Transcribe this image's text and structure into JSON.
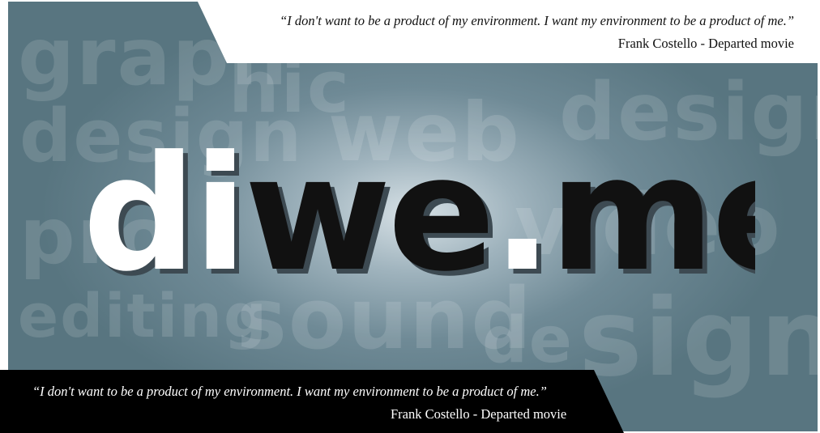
{
  "background_words": [
    "graph",
    "hic",
    "design",
    "web",
    "design",
    "pro",
    "video",
    "editing",
    "sound",
    "de",
    "sign"
  ],
  "logo": {
    "parts": [
      "di",
      "we",
      ".",
      "me"
    ],
    "colors": {
      "white": "#ffffff",
      "black": "#111111",
      "shadow": "#3d4a52",
      "background": "#6f8a96"
    }
  },
  "quote_top": {
    "text": "“I don't want to be a product of my environment. I want my environment to be a product of me.”",
    "author": "Frank Costello - Departed movie"
  },
  "quote_bottom": {
    "text": "“I don't want to be a product of my environment. I want my environment to be a product of me.”",
    "author": "Frank Costello - Departed movie"
  }
}
